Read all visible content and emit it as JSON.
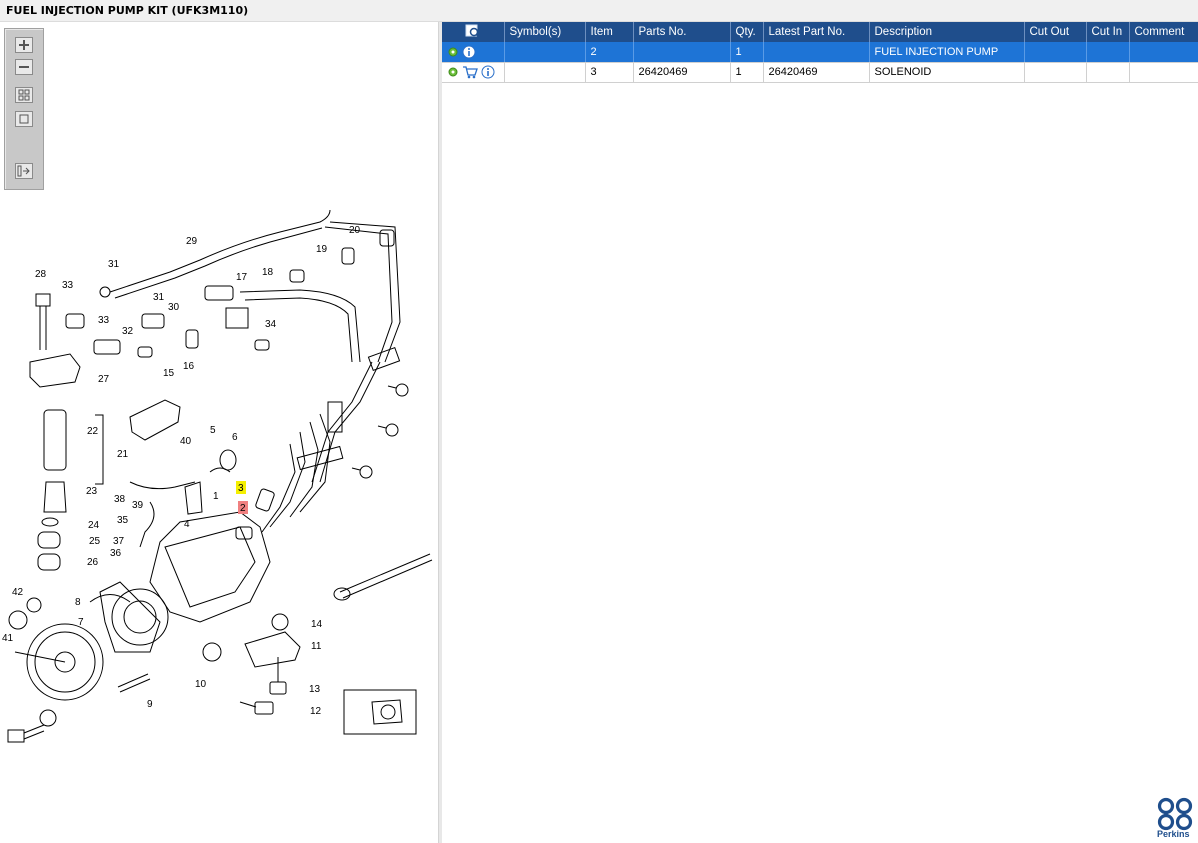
{
  "window": {
    "title": "FUEL INJECTION PUMP KIT (UFK3M110)"
  },
  "toolbar": {
    "buttons": [
      {
        "name": "zoom-in-icon"
      },
      {
        "name": "zoom-out-icon"
      },
      {
        "name": "fit-all-icon"
      },
      {
        "name": "actual-size-icon"
      },
      {
        "name": "toggle-list-icon"
      }
    ]
  },
  "diagram": {
    "callouts": [
      "1",
      "2",
      "3",
      "4",
      "5",
      "6",
      "7",
      "8",
      "9",
      "10",
      "11",
      "12",
      "13",
      "14",
      "15",
      "16",
      "17",
      "18",
      "19",
      "20",
      "21",
      "22",
      "23",
      "24",
      "25",
      "26",
      "27",
      "28",
      "29",
      "30",
      "31",
      "31",
      "32",
      "33",
      "33",
      "34",
      "35",
      "36",
      "37",
      "38",
      "39",
      "40",
      "41",
      "42"
    ],
    "highlighted": {
      "yellow": "3",
      "red": "2"
    }
  },
  "grid": {
    "columns": [
      "",
      "Symbol(s)",
      "Item",
      "Parts No.",
      "Qty.",
      "Latest Part No.",
      "Description",
      "Cut Out",
      "Cut In",
      "Comment"
    ],
    "rows": [
      {
        "selected": true,
        "icons": [
          "gear-icon",
          "info-icon"
        ],
        "symbols": "",
        "item": "2",
        "part_no": "",
        "qty": "1",
        "latest_part_no": "",
        "description": "FUEL INJECTION PUMP",
        "cut_out": "",
        "cut_in": "",
        "comment": ""
      },
      {
        "selected": false,
        "icons": [
          "gear-icon",
          "cart-icon",
          "info-icon"
        ],
        "symbols": "",
        "item": "3",
        "part_no": "26420469",
        "qty": "1",
        "latest_part_no": "26420469",
        "description": "SOLENOID",
        "cut_out": "",
        "cut_in": "",
        "comment": ""
      }
    ]
  },
  "brand": {
    "name": "Perkins",
    "color": "#1f4e8c"
  },
  "colors": {
    "header": "#1f4e8c",
    "selection": "#1e74d6",
    "highlight_yellow": "#f5f000",
    "highlight_red": "#f08080"
  }
}
